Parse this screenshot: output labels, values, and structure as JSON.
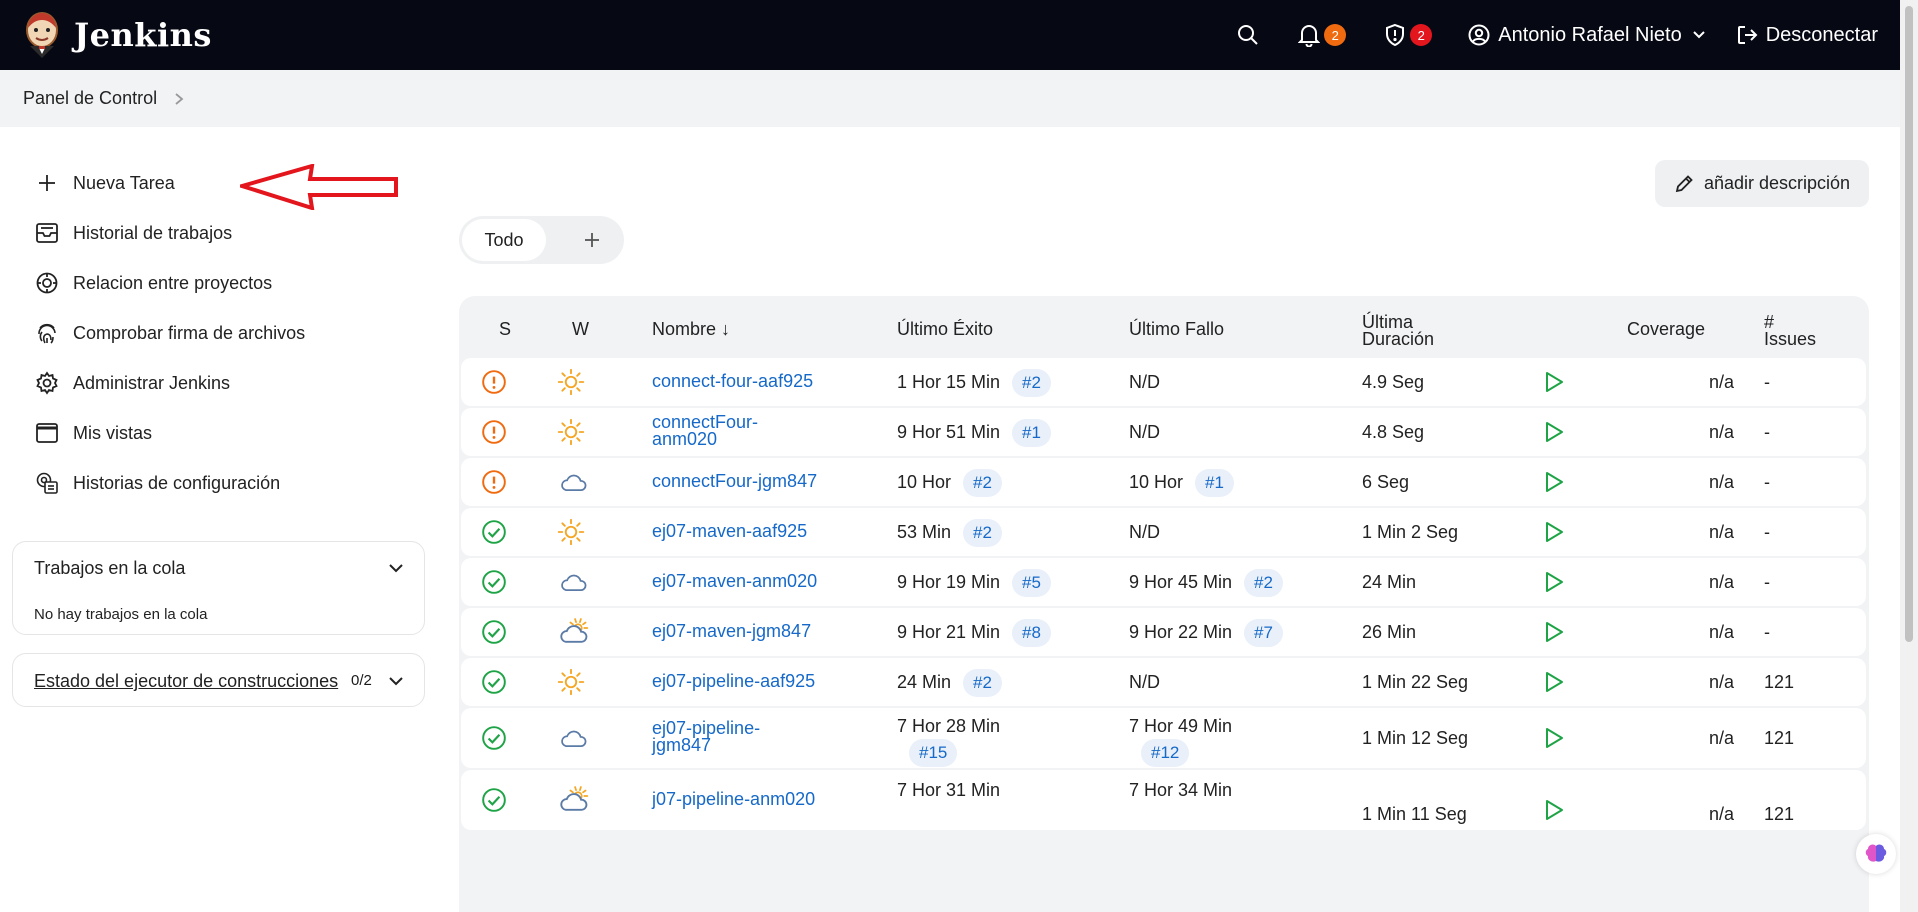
{
  "header": {
    "app_name": "Jenkins",
    "notifications_count": "2",
    "security_count": "2",
    "user_name": "Antonio Rafael Nieto",
    "logout_label": "Desconectar"
  },
  "breadcrumb": {
    "item": "Panel de Control"
  },
  "sidebar": {
    "items": [
      {
        "label": "Nueva Tarea",
        "icon": "plus-icon"
      },
      {
        "label": "Historial de trabajos",
        "icon": "inbox-icon"
      },
      {
        "label": "Relacion entre proyectos",
        "icon": "target-icon"
      },
      {
        "label": "Comprobar firma de archivos",
        "icon": "fingerprint-icon"
      },
      {
        "label": "Administrar Jenkins",
        "icon": "gear-icon"
      },
      {
        "label": "Mis vistas",
        "icon": "window-icon"
      },
      {
        "label": "Historias de configuración",
        "icon": "config-history-icon"
      }
    ],
    "queue": {
      "title": "Trabajos en la cola",
      "empty": "No hay trabajos en la cola"
    },
    "executors": {
      "title": "Estado del ejecutor de construcciones",
      "count": "0/2"
    }
  },
  "main": {
    "add_description": "añadir descripción",
    "tabs": [
      {
        "label": "Todo"
      }
    ],
    "table": {
      "headers": {
        "s": "S",
        "w": "W",
        "name": "Nombre ↓",
        "last_success": "Último Éxito",
        "last_failure": "Último Fallo",
        "last_duration_1": "Última",
        "last_duration_2": "Duración",
        "coverage": "Coverage",
        "issues_1": "#",
        "issues_2": "Issues"
      },
      "rows": [
        {
          "status": "unstable",
          "weather": "sunny",
          "name": "connect-four-aaf925",
          "success": "1 Hor 15 Min",
          "success_build": "#2",
          "failure": "N/D",
          "failure_build": "",
          "duration": "4.9 Seg",
          "coverage": "n/a",
          "issues": "-"
        },
        {
          "status": "unstable",
          "weather": "sunny",
          "name_1": "connectFour-",
          "name_2": "anm020",
          "success": "9 Hor 51 Min",
          "success_build": "#1",
          "failure": "N/D",
          "failure_build": "",
          "duration": "4.8 Seg",
          "coverage": "n/a",
          "issues": "-"
        },
        {
          "status": "unstable",
          "weather": "cloudy",
          "name": "connectFour-jgm847",
          "success": "10 Hor",
          "success_build": "#2",
          "failure": "10 Hor",
          "failure_build": "#1",
          "duration": "6 Seg",
          "coverage": "n/a",
          "issues": "-"
        },
        {
          "status": "success",
          "weather": "sunny",
          "name": "ej07-maven-aaf925",
          "success": "53 Min",
          "success_build": "#2",
          "failure": "N/D",
          "failure_build": "",
          "duration": "1 Min 2 Seg",
          "coverage": "n/a",
          "issues": "-"
        },
        {
          "status": "success",
          "weather": "cloudy",
          "name": "ej07-maven-anm020",
          "success": "9 Hor 19 Min",
          "success_build": "#5",
          "failure": "9 Hor 45 Min",
          "failure_build": "#2",
          "duration": "24 Min",
          "coverage": "n/a",
          "issues": "-"
        },
        {
          "status": "success",
          "weather": "partly-cloudy",
          "name": "ej07-maven-jgm847",
          "success": "9 Hor 21 Min",
          "success_build": "#8",
          "failure": "9 Hor 22 Min",
          "failure_build": "#7",
          "duration": "26 Min",
          "coverage": "n/a",
          "issues": "-"
        },
        {
          "status": "success",
          "weather": "sunny",
          "name": "ej07-pipeline-aaf925",
          "success": "24 Min",
          "success_build": "#2",
          "failure": "N/D",
          "failure_build": "",
          "duration": "1 Min 22 Seg",
          "coverage": "n/a",
          "issues": "121"
        },
        {
          "status": "success",
          "weather": "cloudy",
          "name_1": "ej07-pipeline-",
          "name_2": "jgm847",
          "success": "7 Hor 28 Min",
          "success_build": "#15",
          "failure": "7 Hor 49 Min",
          "failure_build": "#12",
          "duration": "1 Min 12 Seg",
          "coverage": "n/a",
          "issues": "121"
        },
        {
          "status": "success",
          "weather": "partly-cloudy",
          "name": "j07-pipeline-anm020",
          "success": "7 Hor 31 Min",
          "success_build": "",
          "failure": "7 Hor 34 Min",
          "failure_build": "",
          "duration": "1 Min 11 Seg",
          "coverage": "n/a",
          "issues": "121"
        }
      ]
    }
  },
  "colors": {
    "topbar": "#060814",
    "link": "#1669c8",
    "success": "#1ea446",
    "unstable": "#f06a10",
    "sun": "#f5a623",
    "cloud": "#5b7ba6",
    "annotation": "#e3161e"
  }
}
